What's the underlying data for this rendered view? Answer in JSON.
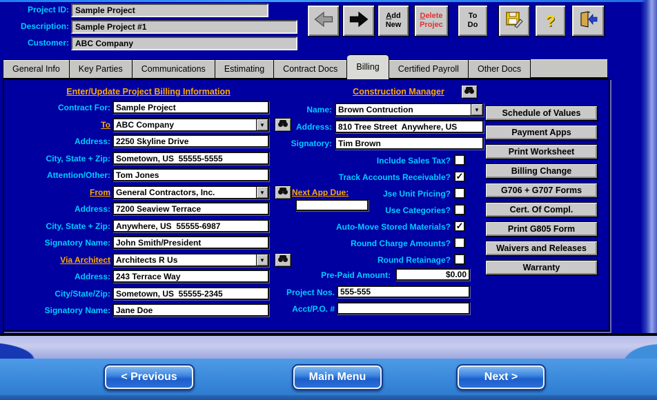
{
  "header": {
    "fields": [
      {
        "label": "Project ID:",
        "value": "Sample Project"
      },
      {
        "label": "Description:",
        "value": "Sample Project #1"
      },
      {
        "label": "Customer:",
        "value": "ABC Company"
      }
    ],
    "toolbar": {
      "add_new": {
        "line1": "Add",
        "line2": "New"
      },
      "delete_project": {
        "line1": "Delete",
        "line2": "Projec"
      },
      "to_do": {
        "line1": "To",
        "line2": "Do"
      },
      "help_glyph": "?"
    }
  },
  "tabs": [
    {
      "label": "General Info",
      "active": false
    },
    {
      "label": "Key Parties",
      "active": false
    },
    {
      "label": "Communications",
      "active": false
    },
    {
      "label": "Estimating",
      "active": false
    },
    {
      "label": "Contract Docs",
      "active": false
    },
    {
      "label": "Billing",
      "active": true
    },
    {
      "label": "Certified Payroll",
      "active": false
    },
    {
      "label": "Other Docs",
      "active": false
    }
  ],
  "billing": {
    "heading": "Enter/Update Project Billing Information",
    "left": [
      {
        "label": "Contract For:",
        "value": "Sample Project",
        "type": "text"
      },
      {
        "label": "To",
        "value": "ABC Company",
        "type": "combo"
      },
      {
        "label": "Address:",
        "value": "2250 Skyline Drive",
        "type": "text"
      },
      {
        "label": "City, State + Zip:",
        "value": "Sometown, US  55555-5555",
        "type": "text"
      },
      {
        "label": "Attention/Other:",
        "value": "Tom Jones",
        "type": "text"
      },
      {
        "label": "From",
        "value": "General Contractors, Inc.",
        "type": "combo"
      },
      {
        "label": "Address:",
        "value": "7200 Seaview Terrace",
        "type": "text"
      },
      {
        "label": "City, State + Zip:",
        "value": "Anywhere, US  55555-6987",
        "type": "text"
      },
      {
        "label": "Signatory Name:",
        "value": "John Smith/President",
        "type": "text"
      },
      {
        "label": "Via Architect",
        "value": "Architects R Us",
        "type": "combo"
      },
      {
        "label": "Address:",
        "value": "243 Terrace Way",
        "type": "text"
      },
      {
        "label": "City/State/Zip:",
        "value": "Sometown, US  55555-2345",
        "type": "text"
      },
      {
        "label": "Signatory Name:",
        "value": "Jane Doe",
        "type": "text"
      }
    ],
    "cm_heading": "Construction Manager",
    "cm": [
      {
        "label": "Name:",
        "value": "Brown Contruction"
      },
      {
        "label": "Address:",
        "value": "810 Tree Street  Anywhere, US"
      },
      {
        "label": "Signatory:",
        "value": "Tim Brown"
      }
    ],
    "options": [
      {
        "label": "Include Sales Tax?",
        "checked": false,
        "glyph": ""
      },
      {
        "label": "Track Accounts Receivable?",
        "checked": true,
        "glyph": "✓"
      },
      {
        "label": "Jse Unit Pricing?",
        "checked": false,
        "glyph": ""
      },
      {
        "label": "Use Categories?",
        "checked": false,
        "glyph": ""
      },
      {
        "label": "Auto-Move Stored Materials?",
        "checked": true,
        "glyph": "✓"
      },
      {
        "label": "Round Charge Amounts?",
        "checked": false,
        "glyph": ""
      },
      {
        "label": "Round Retainage?",
        "checked": false,
        "glyph": ""
      }
    ],
    "next_app_due": {
      "label": "Next App Due:",
      "value": ""
    },
    "prepaid": {
      "label": "Pre-Paid Amount:",
      "value": "$0.00"
    },
    "project_nos": {
      "label": "Project Nos.",
      "value": "555-555"
    },
    "acct_po": {
      "label": "Acct/P.O. #",
      "value": ""
    },
    "action_buttons": [
      "Schedule of Values",
      "Payment Apps",
      "Print Worksheet",
      "Billing Change",
      "G706 + G707 Forms",
      "Cert. Of Compl.",
      "Print G805 Form",
      "Waivers and Releases",
      "Warranty"
    ]
  },
  "icons": {
    "dropdown": "▼",
    "check": "✓"
  },
  "footer": {
    "previous": "< Previous",
    "main_menu": "Main Menu",
    "next": "Next >"
  },
  "colors": {
    "label_cyan": "#00CCFF",
    "link_orange": "#FFAA00",
    "bg_blue": "#0000A0",
    "delete_red": "#E03232"
  }
}
